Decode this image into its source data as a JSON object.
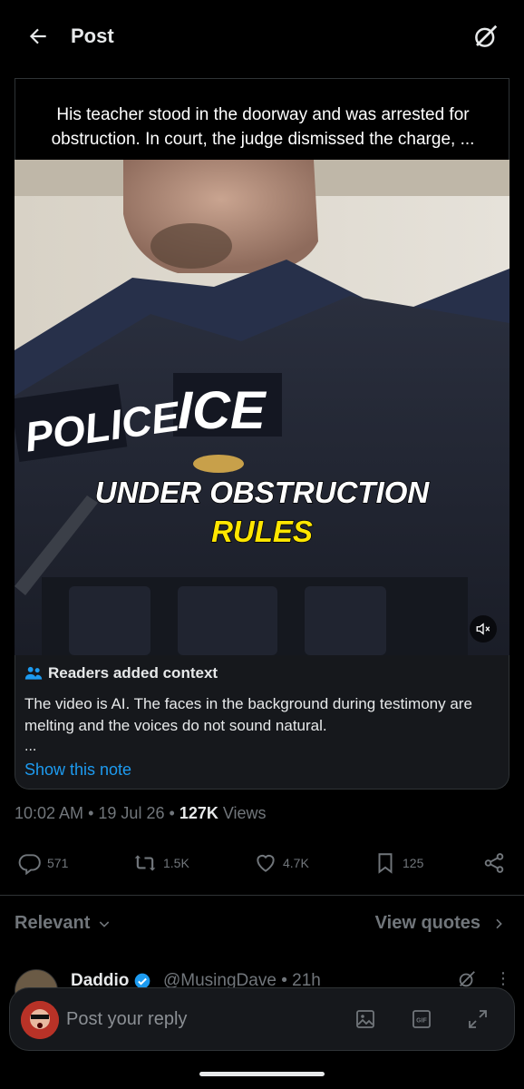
{
  "header": {
    "title": "Post"
  },
  "post": {
    "caption": "His teacher stood in the doorway and was arrested for obstruction. In court, the judge dismissed the charge, ...",
    "video_overlay": {
      "patch_left": "POLICE",
      "patch_right": "ICE",
      "line1": "UNDER OBSTRUCTION",
      "line2": "RULES"
    },
    "note": {
      "title": "Readers added context",
      "body": "The video is AI. The faces in the background during testimony are melting and the voices do not sound natural.",
      "ellipsis": "...",
      "link": "Show this note"
    },
    "meta": {
      "time": "10:02 AM",
      "sep1": "•",
      "date": "19 Jul 26",
      "sep2": "•",
      "views_count": "127K",
      "views_label": "Views"
    },
    "actions": {
      "replies": "571",
      "reposts": "1.5K",
      "likes": "4.7K",
      "bookmarks": "125"
    }
  },
  "filter": {
    "relevant_label": "Relevant",
    "view_quotes_label": "View quotes"
  },
  "reply": {
    "name": "Daddio",
    "handle": "@MusingDave",
    "sep": "•",
    "time": "21h"
  },
  "composer": {
    "placeholder": "Post your reply"
  },
  "colors": {
    "accent": "#1d9bf0",
    "text_secondary": "#71767b",
    "background": "#000000",
    "note_bg": "#16181c",
    "caption_yellow": "#ffe600"
  },
  "icons": [
    "back-arrow-icon",
    "grok-icon",
    "mute-icon",
    "readers-icon",
    "reply-icon",
    "repost-icon",
    "like-icon",
    "bookmark-icon",
    "share-icon",
    "chevron-down-icon",
    "chevron-right-icon",
    "verified-icon",
    "more-icon",
    "image-icon",
    "gif-icon",
    "expand-icon"
  ]
}
